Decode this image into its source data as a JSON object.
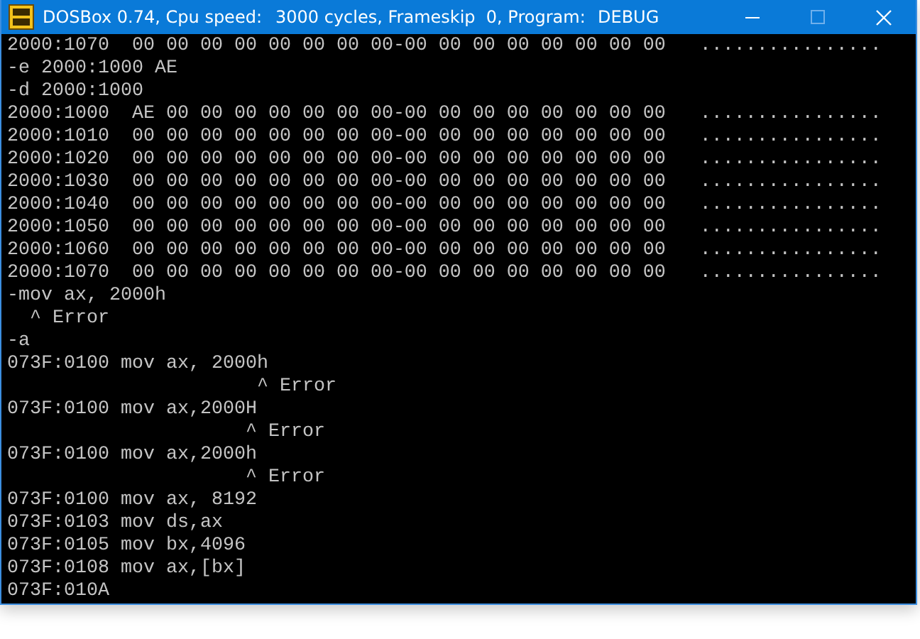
{
  "window": {
    "title_parts": [
      "DOSBox 0.74, Cpu speed:",
      "3000 cycles, Frameskip  0, Program:",
      "DEBUG"
    ]
  },
  "console": {
    "lines": [
      "2000:1070  00 00 00 00 00 00 00 00-00 00 00 00 00 00 00 00   ................",
      "-e 2000:1000 AE",
      "-d 2000:1000",
      "2000:1000  AE 00 00 00 00 00 00 00-00 00 00 00 00 00 00 00   ................",
      "2000:1010  00 00 00 00 00 00 00 00-00 00 00 00 00 00 00 00   ................",
      "2000:1020  00 00 00 00 00 00 00 00-00 00 00 00 00 00 00 00   ................",
      "2000:1030  00 00 00 00 00 00 00 00-00 00 00 00 00 00 00 00   ................",
      "2000:1040  00 00 00 00 00 00 00 00-00 00 00 00 00 00 00 00   ................",
      "2000:1050  00 00 00 00 00 00 00 00-00 00 00 00 00 00 00 00   ................",
      "2000:1060  00 00 00 00 00 00 00 00-00 00 00 00 00 00 00 00   ................",
      "2000:1070  00 00 00 00 00 00 00 00-00 00 00 00 00 00 00 00   ................",
      "-mov ax, 2000h",
      "  ^ Error",
      "-a",
      "073F:0100 mov ax, 2000h",
      "                      ^ Error",
      "073F:0100 mov ax,2000H",
      "                     ^ Error",
      "073F:0100 mov ax,2000h",
      "                     ^ Error",
      "073F:0100 mov ax, 8192",
      "073F:0103 mov ds,ax",
      "073F:0105 mov bx,4096",
      "073F:0108 mov ax,[bx]",
      "073F:010A"
    ]
  }
}
